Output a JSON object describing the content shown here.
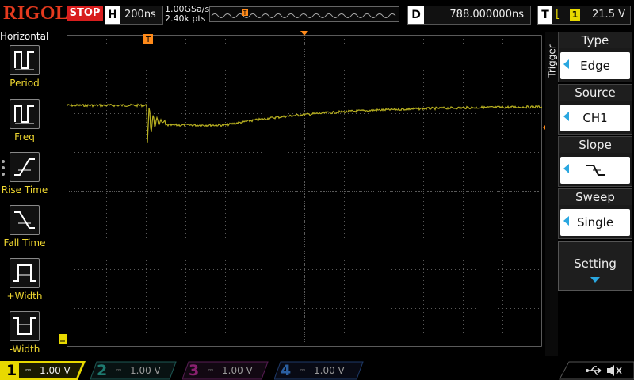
{
  "topbar": {
    "logo": "RIGOL",
    "run_state": "STOP",
    "horizontal": {
      "key": "H",
      "timebase": "200ns"
    },
    "acquisition": {
      "sample_rate": "1.00GSa/s",
      "memory_depth": "2.40k pts"
    },
    "delay": {
      "key": "D",
      "value": "788.000000ns"
    },
    "trigger": {
      "key": "T",
      "edge_glyph": "⌊",
      "channel": "1",
      "level": "21.5 V"
    },
    "trigger_marker": "T"
  },
  "left_menu": {
    "title": "Horizontal",
    "items": [
      {
        "label": "Period",
        "icon": "period-icon"
      },
      {
        "label": "Freq",
        "icon": "freq-icon"
      },
      {
        "label": "Rise Time",
        "icon": "rise-time-icon"
      },
      {
        "label": "Fall Time",
        "icon": "fall-time-icon"
      },
      {
        "label": "+Width",
        "icon": "positive-width-icon"
      },
      {
        "label": "-Width",
        "icon": "negative-width-icon"
      }
    ]
  },
  "right_menu": {
    "tab_label": "Trigger",
    "items": [
      {
        "title": "Type",
        "value": "Edge"
      },
      {
        "title": "Source",
        "value": "CH1"
      },
      {
        "title": "Slope",
        "value": "falling-edge-icon"
      },
      {
        "title": "Sweep",
        "value": "Single"
      }
    ],
    "setting_label": "Setting"
  },
  "channels": [
    {
      "num": "1",
      "coupling_glyph": "⎓",
      "scale": "1.00 V",
      "color": "#e8d900",
      "active": true
    },
    {
      "num": "2",
      "coupling_glyph": "⎓",
      "scale": "1.00 V",
      "color": "#1e9a8a",
      "active": false
    },
    {
      "num": "3",
      "coupling_glyph": "⎓",
      "scale": "1.00 V",
      "color": "#b0268a",
      "active": false
    },
    {
      "num": "4",
      "coupling_glyph": "⎓",
      "scale": "1.00 V",
      "color": "#1e5fb0",
      "active": false
    }
  ],
  "colors": {
    "trace": "#b8b020",
    "trigger_marker": "#ff8a1a",
    "stop": "#d81e1e",
    "accent": "#2aa7e0",
    "grid": "#5a5a5a"
  }
}
